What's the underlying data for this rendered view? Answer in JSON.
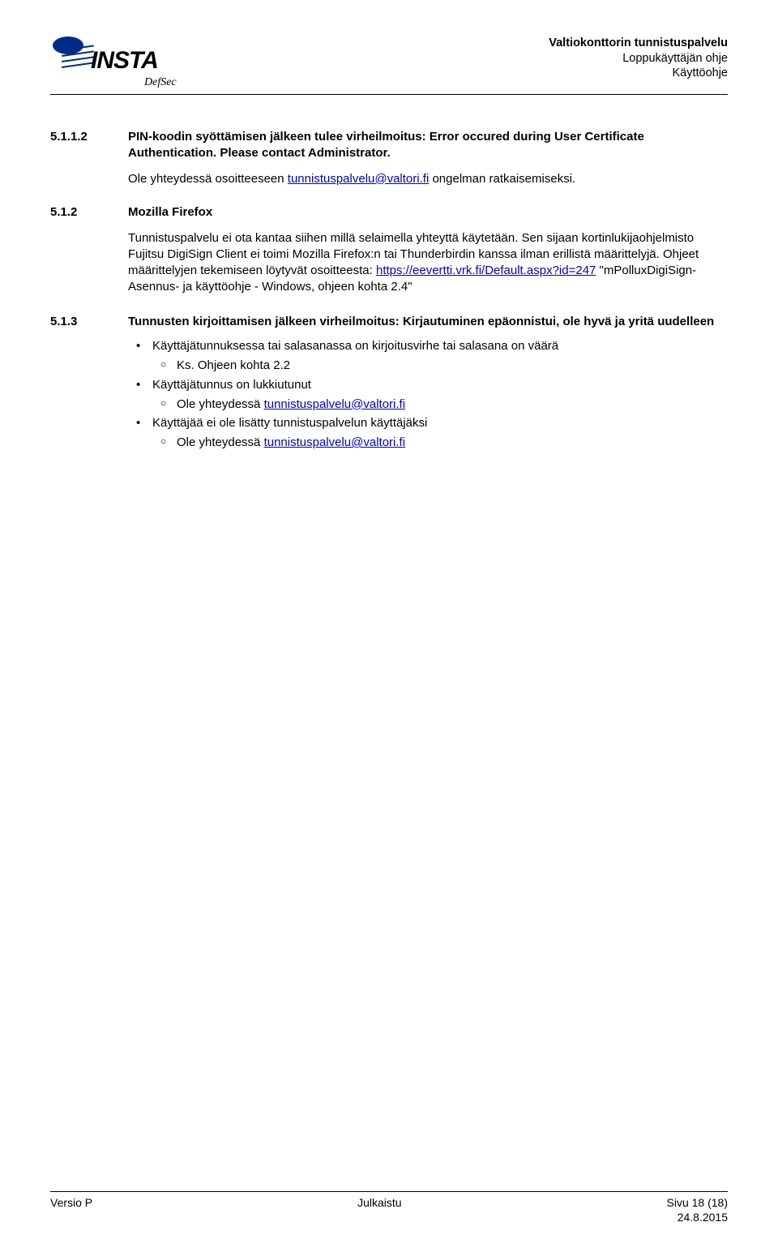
{
  "header": {
    "logo_text": "INSTA",
    "logo_subtitle": "DefSec",
    "title_line1": "Valtiokonttorin tunnistuspalvelu",
    "title_line2": "Loppukäyttäjän ohje",
    "title_line3": "Käyttöohje"
  },
  "sections": {
    "s1": {
      "num": "5.1.1.2",
      "title": "PIN-koodin syöttämisen jälkeen tulee virheilmoitus: Error occured during User Certificate Authentication. Please contact Administrator.",
      "p1_prefix": "Ole yhteydessä osoitteeseen ",
      "p1_link": "tunnistuspalvelu@valtori.fi",
      "p1_suffix": " ongelman ratkaisemiseksi."
    },
    "s2": {
      "num": "5.1.2",
      "title": "Mozilla Firefox",
      "p1_a": "Tunnistuspalvelu ei ota kantaa siihen millä selaimella yhteyttä käytetään. Sen sijaan kortinlukijaohjelmisto Fujitsu DigiSign Client ei toimi Mozilla Firefox:n tai Thunderbirdin kanssa ilman erillistä määrittelyjä. Ohjeet määrittelyjen tekemiseen löytyvät osoitteesta: ",
      "p1_link": "https://eevertti.vrk.fi/Default.aspx?id=247",
      "p1_b": " \"mPolluxDigiSign-Asennus- ja käyttöohje - Windows, ohjeen kohta 2.4\""
    },
    "s3": {
      "num": "5.1.3",
      "title": "Tunnusten kirjoittamisen jälkeen virheilmoitus: Kirjautuminen epäonnistui, ole hyvä ja yritä uudelleen",
      "b1": "Käyttäjätunnuksessa tai salasanassa on kirjoitusvirhe tai salasana on väärä",
      "b1s1": "Ks. Ohjeen kohta 2.2",
      "b2": "Käyttäjätunnus on lukkiutunut",
      "b2s1_prefix": "Ole yhteydessä ",
      "b2s1_link": "tunnistuspalvelu@valtori.fi",
      "b3": "Käyttäjää ei ole lisätty tunnistuspalvelun käyttäjäksi",
      "b3s1_prefix": "Ole yhteydessä ",
      "b3s1_link": "tunnistuspalvelu@valtori.fi"
    }
  },
  "footer": {
    "left": "Versio P",
    "center": "Julkaistu",
    "right_line1": "Sivu 18 (18)",
    "right_line2": "24.8.2015"
  }
}
